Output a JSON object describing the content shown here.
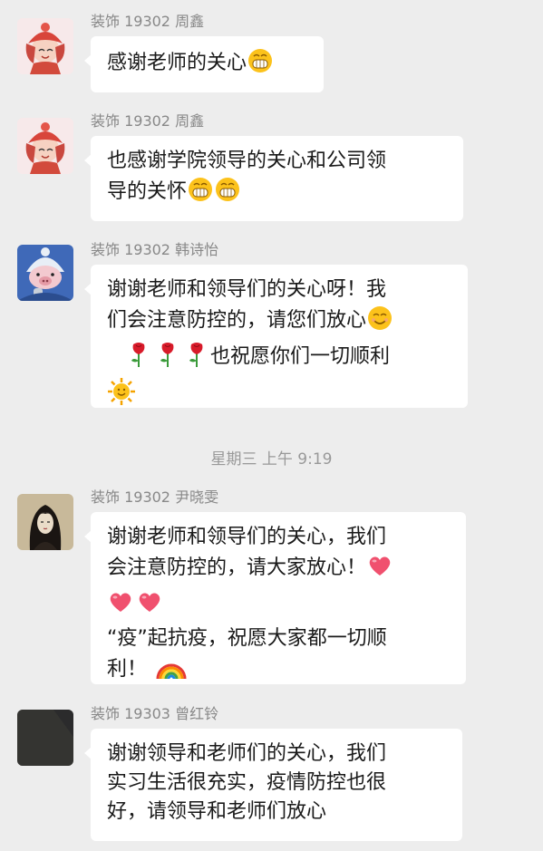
{
  "messages": [
    {
      "sender": "装饰 19302 周鑫",
      "avatar": "avatar-cartoon-girl-red-hat",
      "lines": [
        {
          "text": "感谢老师的关心",
          "emojis": [
            "grin-emoji"
          ]
        }
      ]
    },
    {
      "sender": "装饰 19302 周鑫",
      "avatar": "avatar-cartoon-girl-red-hat",
      "lines": [
        {
          "text": "也感谢学院领导的关心和公司领",
          "emojis": []
        },
        {
          "text": "导的关怀",
          "emojis": [
            "grin-emoji",
            "grin-emoji"
          ]
        }
      ]
    },
    {
      "sender": "装饰 19302  韩诗怡",
      "avatar": "avatar-blue-hat-pig",
      "lines": [
        {
          "text": "谢谢老师和领导们的关心呀！我",
          "emojis": []
        },
        {
          "text": "们会注意防控的，请您们放心",
          "emojis": [
            "smile-emoji"
          ]
        },
        {
          "text": "也祝愿你们一切顺利",
          "emojis": [
            "rose-emoji",
            "rose-emoji",
            "rose-emoji"
          ],
          "emojisFirst": true
        },
        {
          "text": "",
          "emojis": [
            "sun-emoji"
          ]
        }
      ]
    },
    {
      "sender": "装饰 19302  尹晓雯",
      "avatar": "avatar-dark-illustration",
      "lines": [
        {
          "text": "谢谢老师和领导们的关心，我们",
          "emojis": []
        },
        {
          "text": "会注意防控的，请大家放心！",
          "emojis": [
            "heart-emoji"
          ]
        },
        {
          "text": "",
          "emojis": [
            "heart-emoji",
            "heart-emoji"
          ]
        },
        {
          "text": "“疫”起抗疫，祝愿大家都一切顺",
          "emojis": []
        },
        {
          "text": "利！",
          "emojis": [
            "rainbow-emoji"
          ]
        }
      ]
    },
    {
      "sender": "装饰 19303  曾红铃",
      "avatar": "avatar-dark-photo",
      "lines": [
        {
          "text": "谢谢领导和老师们的关心，我们",
          "emojis": []
        },
        {
          "text": "实习生活很充实，疫情防控也很",
          "emojis": []
        },
        {
          "text": "好，请领导和老师们放心",
          "emojis": []
        }
      ]
    }
  ],
  "timestamp": "星期三 上午 9:19"
}
